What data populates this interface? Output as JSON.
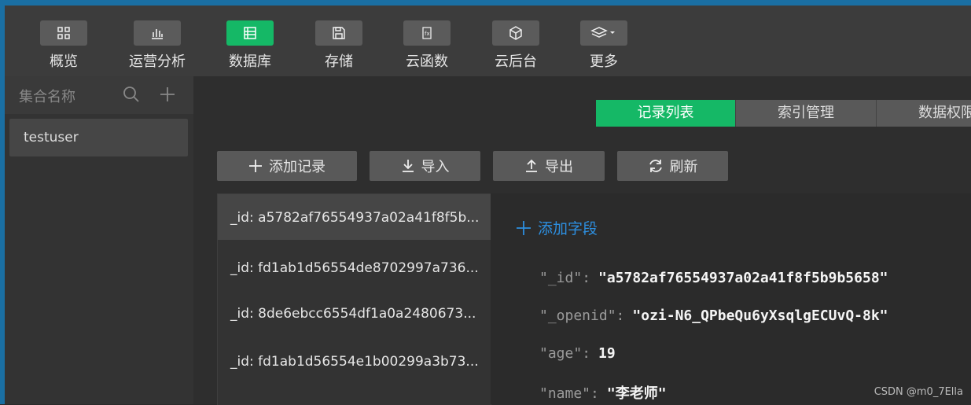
{
  "toolbar": {
    "items": [
      {
        "label": "概览",
        "icon": "grid-icon"
      },
      {
        "label": "运营分析",
        "icon": "bar-chart-icon"
      },
      {
        "label": "数据库",
        "icon": "database-icon"
      },
      {
        "label": "存储",
        "icon": "save-icon"
      },
      {
        "label": "云函数",
        "icon": "function-icon"
      },
      {
        "label": "云后台",
        "icon": "cube-icon"
      },
      {
        "label": "更多",
        "icon": "layers-icon"
      }
    ],
    "active_index": 2
  },
  "sidebar": {
    "title": "集合名称",
    "collections": [
      "testuser"
    ]
  },
  "tabs": [
    "记录列表",
    "索引管理",
    "数据权限"
  ],
  "actions": {
    "add_record": "添加记录",
    "import": "导入",
    "export": "导出",
    "refresh": "刷新"
  },
  "records": [
    "_id: a5782af76554937a02a41f8f5b...",
    "_id: fd1ab1d56554de8702997a736...",
    "_id: 8de6ebcc6554df1a0a2480673...",
    "_id: fd1ab1d56554e1b00299a3b73..."
  ],
  "detail": {
    "add_field": "添加字段",
    "fields": [
      {
        "key": "\"_id\"",
        "value": "\"a5782af76554937a02a41f8f5b9b5658\""
      },
      {
        "key": "\"_openid\"",
        "value": "\"ozi-N6_QPbeQu6yXsqlgECUvQ-8k\""
      },
      {
        "key": "\"age\"",
        "value": "19"
      },
      {
        "key": "\"name\"",
        "value": "\"李老师\""
      }
    ]
  },
  "watermark": "CSDN @m0_7Ella",
  "colors": {
    "accent": "#15b866",
    "link": "#2d8fe0",
    "topbar": "#1a6fa3"
  }
}
